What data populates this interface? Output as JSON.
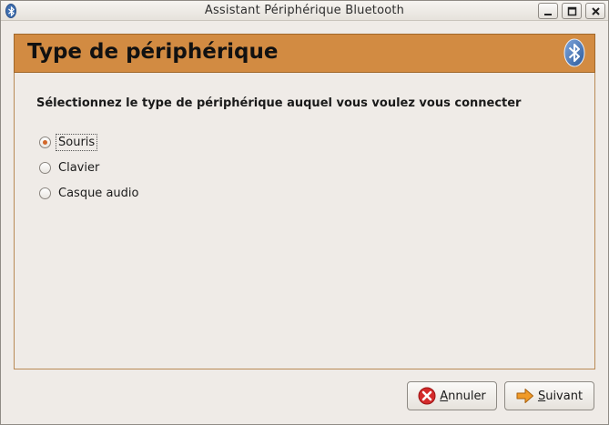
{
  "window": {
    "title": "Assistant Périphérique Bluetooth"
  },
  "header": {
    "title": "Type de périphérique"
  },
  "content": {
    "prompt": "Sélectionnez le type de périphérique auquel vous voulez vous connecter",
    "options": [
      {
        "label": "Souris",
        "checked": true
      },
      {
        "label": "Clavier",
        "checked": false
      },
      {
        "label": "Casque audio",
        "checked": false
      }
    ]
  },
  "buttons": {
    "cancel_mnemonic": "A",
    "cancel_rest": "nnuler",
    "next_mnemonic": "S",
    "next_rest": "uivant"
  },
  "colors": {
    "banner": "#d28b42",
    "radio_dot": "#d2672a",
    "bluetooth": "#3f6fb0"
  },
  "icons": {
    "title": "bluetooth-icon",
    "banner": "bluetooth-logo-icon",
    "cancel": "cancel-x-icon",
    "next": "arrow-right-icon"
  }
}
